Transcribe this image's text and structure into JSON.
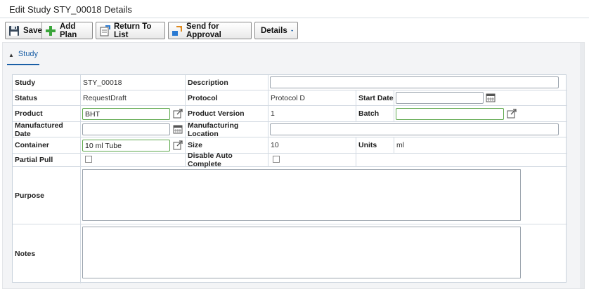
{
  "header": {
    "title": "Edit Study STY_00018 Details"
  },
  "toolbar": {
    "save_label": "Save",
    "add_plan_label": "Add Plan",
    "return_label": "Return To List",
    "approval_label": "Send for Approval",
    "details_label": "Details"
  },
  "tab": {
    "label": "Study"
  },
  "form": {
    "study": {
      "label": "Study",
      "value": "STY_00018"
    },
    "description": {
      "label": "Description",
      "value": ""
    },
    "status": {
      "label": "Status",
      "value": "RequestDraft"
    },
    "protocol": {
      "label": "Protocol",
      "value": "Protocol D"
    },
    "start_date": {
      "label": "Start Date",
      "value": ""
    },
    "product": {
      "label": "Product",
      "value": "BHT"
    },
    "product_version": {
      "label": "Product Version",
      "value": "1"
    },
    "batch": {
      "label": "Batch",
      "value": ""
    },
    "manufactured_date": {
      "label": "Manufactured Date",
      "value": ""
    },
    "manufacturing_location": {
      "label": "Manufacturing Location",
      "value": ""
    },
    "container": {
      "label": "Container",
      "value": "10 ml Tube"
    },
    "size": {
      "label": "Size",
      "value": "10"
    },
    "units": {
      "label": "Units",
      "value": "ml"
    },
    "partial_pull": {
      "label": "Partial Pull",
      "checked": false
    },
    "disable_auto_complete": {
      "label": "Disable Auto Complete",
      "checked": false
    },
    "purpose": {
      "label": "Purpose",
      "value": ""
    },
    "notes": {
      "label": "Notes",
      "value": ""
    }
  },
  "icons": {
    "save": "floppy-disk-icon",
    "add_plan": "plus-icon",
    "return": "return-list-icon",
    "approval": "send-approval-icon",
    "details_caret": "caret-down-icon",
    "calendar": "calendar-icon",
    "lookup": "open-lookup-icon"
  },
  "colors": {
    "accent": "#1a5fa6",
    "valid_border": "#5fa94e",
    "panel_bg": "#f3f4f6"
  }
}
